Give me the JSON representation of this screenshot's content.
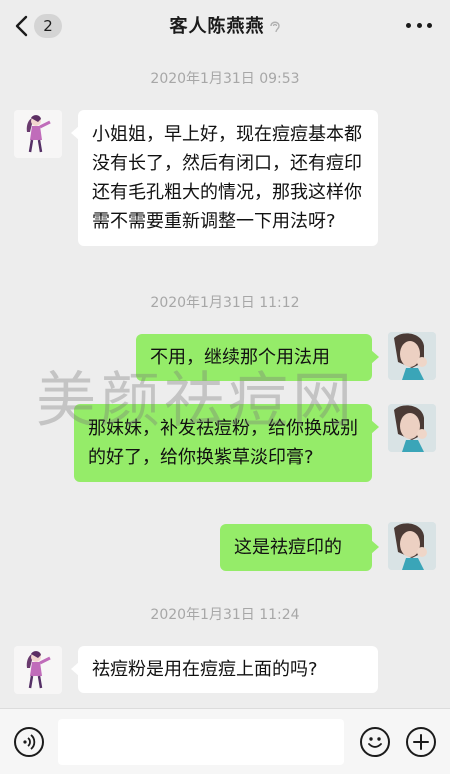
{
  "header": {
    "back_badge": "2",
    "title": "客人陈燕燕"
  },
  "messages": [
    {
      "type": "time",
      "text": "2020年1月31日 09:53"
    },
    {
      "type": "in",
      "text": "小姐姐，早上好，现在痘痘基本都没有长了，然后有闭口，还有痘印还有毛孔粗大的情况，那我这样你需不需要重新调整一下用法呀?"
    },
    {
      "type": "time",
      "text": "2020年1月31日 11:12"
    },
    {
      "type": "out",
      "text": "不用，继续那个用法用"
    },
    {
      "type": "out",
      "text": "那妹妹，补发祛痘粉，给你换成别的好了，给你换紫草淡印膏?"
    },
    {
      "type": "out",
      "text": "这是祛痘印的"
    },
    {
      "type": "time",
      "text": "2020年1月31日 11:24"
    },
    {
      "type": "in",
      "text": "祛痘粉是用在痘痘上面的吗?"
    }
  ],
  "watermark": "美颜祛痘网",
  "icons": {
    "back": "chevron-left-icon",
    "mute": "mute-ear-icon",
    "more": "more-dots-icon",
    "voice": "voice-icon",
    "emoji": "emoji-icon",
    "plus": "plus-icon"
  },
  "colors": {
    "background": "#ededed",
    "incoming_bubble": "#ffffff",
    "outgoing_bubble": "#95ec69",
    "time_text": "#a7a7a7"
  }
}
